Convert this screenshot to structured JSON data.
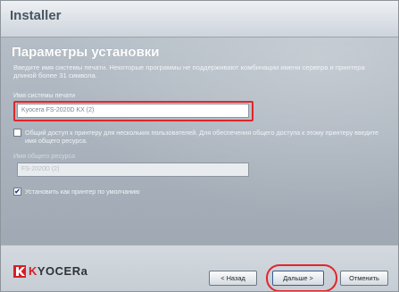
{
  "window": {
    "title": "Installer"
  },
  "page": {
    "heading": "Параметры установки",
    "description": "Введите имя системы печати. Некоторые программы не поддерживают комбинации имени сервера и принтера длиной более 31 символа."
  },
  "printer_name": {
    "label": "Имя системы печати",
    "value": "Kyocera FS-2020D KX (2)"
  },
  "sharing": {
    "checkbox_label": "Общий доступ к принтеру для нескольких пользователей. Для обеспечения общего доступа к этому принтеру введите имя общего ресурса.",
    "checked": false,
    "mark": "",
    "share_label": "Имя общего ресурса",
    "share_value": "FS-2020D (2)"
  },
  "default_printer": {
    "checkbox_label": "Установить как принтер по умолчанию",
    "checked": true,
    "mark": "✔"
  },
  "footer": {
    "logo_text": "KYOCERa",
    "logo_color": "#d71f26",
    "back_label": "< Назад",
    "next_label": "Дальше >",
    "cancel_label": "Отменить"
  },
  "annotation_color": "#e0262c"
}
